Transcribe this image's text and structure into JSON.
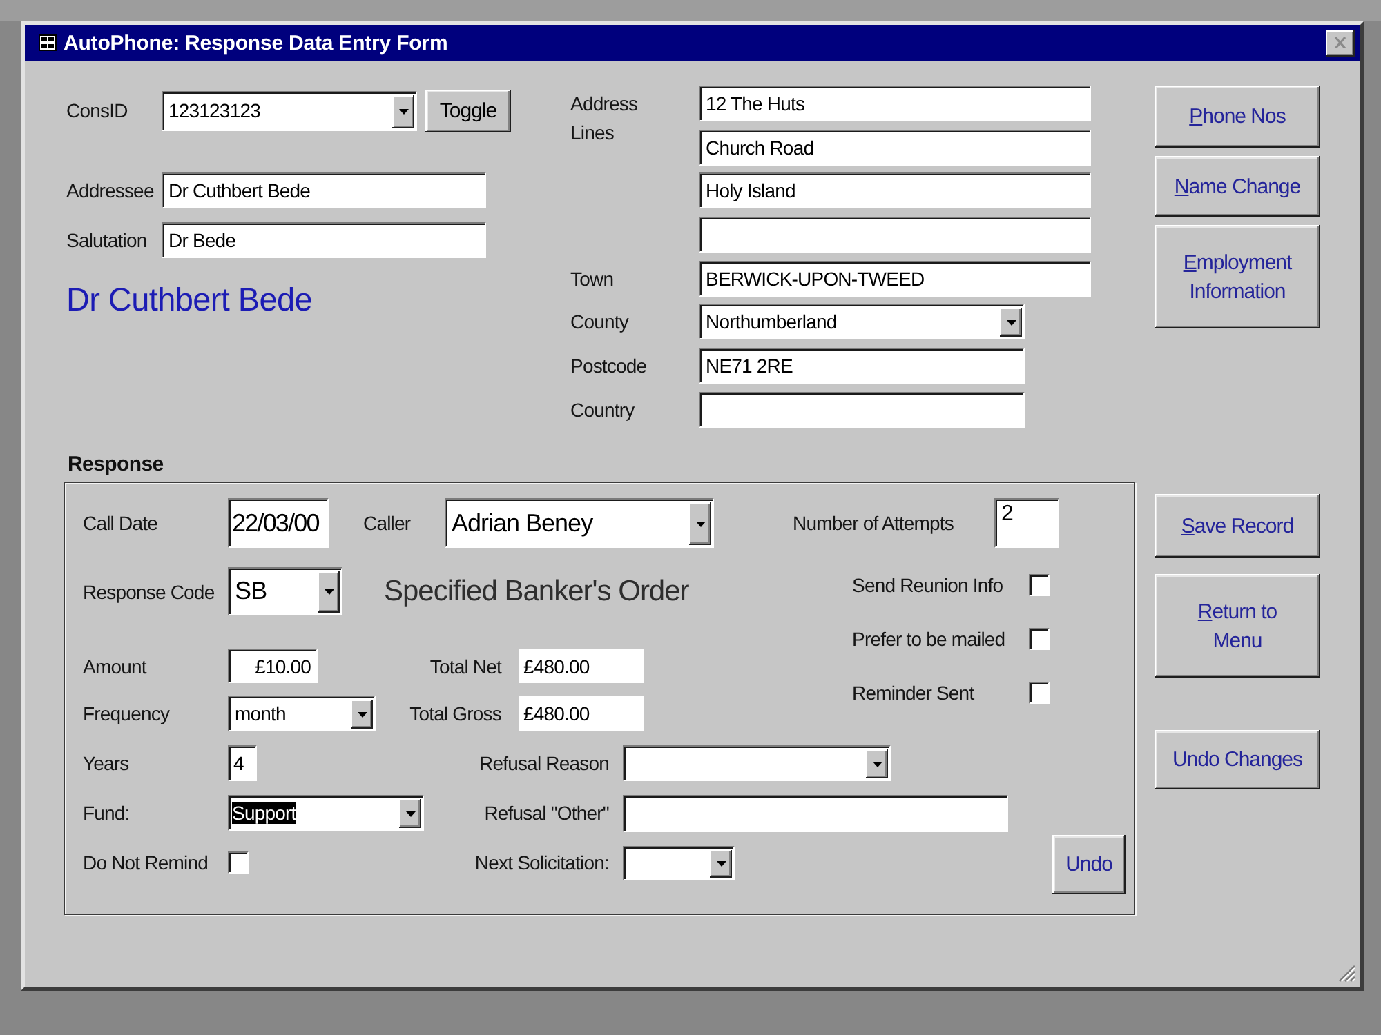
{
  "window": {
    "title": "AutoPhone: Response Data Entry Form"
  },
  "contact": {
    "consid": {
      "label": "ConsID",
      "value": "123123123"
    },
    "toggle_button": {
      "label": "Toggle"
    },
    "addressee": {
      "label": "Addressee",
      "value": "Dr Cuthbert Bede"
    },
    "salutation": {
      "label": "Salutation",
      "value": "Dr Bede"
    },
    "display_name": "Dr Cuthbert Bede"
  },
  "address": {
    "label": "Address Lines",
    "lines": [
      "12 The Huts",
      "Church Road",
      "Holy Island"
    ],
    "spare_line": true,
    "town": {
      "label": "Town",
      "value": "BERWICK-UPON-TWEED"
    },
    "county": {
      "label": "County",
      "value": "Northumberland"
    },
    "postcode": {
      "label": "Postcode",
      "value": "NE71 2RE"
    },
    "country": {
      "label": "Country"
    }
  },
  "side_buttons": [
    {
      "lines": [
        "Phone Nos"
      ],
      "access_key": true
    },
    {
      "lines": [
        "Name Change"
      ],
      "access_key": true
    },
    {
      "lines": [
        "Employment",
        "Information"
      ],
      "access_key": true
    }
  ],
  "response": {
    "title": "Response",
    "call_date": {
      "label": "Call Date",
      "value": "22/03/00"
    },
    "caller": {
      "label": "Caller",
      "value": "Adrian Beney"
    },
    "attempts": {
      "label": "Number of Attempts",
      "value": "2"
    },
    "response_code": {
      "label": "Response Code",
      "value": "SB"
    },
    "response_description": "Specified Banker's Order",
    "amount": {
      "label": "Amount",
      "value": "£10.00"
    },
    "total_net": {
      "label": "Total Net",
      "value": "£480.00"
    },
    "frequency": {
      "label": "Frequency",
      "value": "month"
    },
    "total_gross": {
      "label": "Total Gross",
      "value": "£480.00"
    },
    "flags": [
      {
        "label": "Send Reunion Info",
        "checked": false
      },
      {
        "label": "Prefer to be mailed",
        "checked": false
      },
      {
        "label": "Reminder Sent",
        "checked": false
      }
    ],
    "years": {
      "label": "Years",
      "value": "4"
    },
    "refusal_reason": {
      "label": "Refusal Reason"
    },
    "fund": {
      "label": "Fund:",
      "value": "Support",
      "text_selected": true
    },
    "refusal_other": {
      "label": "Refusal \"Other\""
    },
    "do_not_remind": {
      "label": "Do Not Remind",
      "checked": false
    },
    "next_solicitation": {
      "label": "Next Solicitation:"
    },
    "undo_button": {
      "label": "Undo"
    }
  },
  "record_buttons": [
    {
      "lines": [
        "Save Record"
      ],
      "access_key": true
    },
    {
      "lines": [
        "Return to",
        "Menu"
      ],
      "access_key": true
    },
    {
      "lines": [
        "Undo Changes"
      ],
      "access_key": false
    }
  ]
}
